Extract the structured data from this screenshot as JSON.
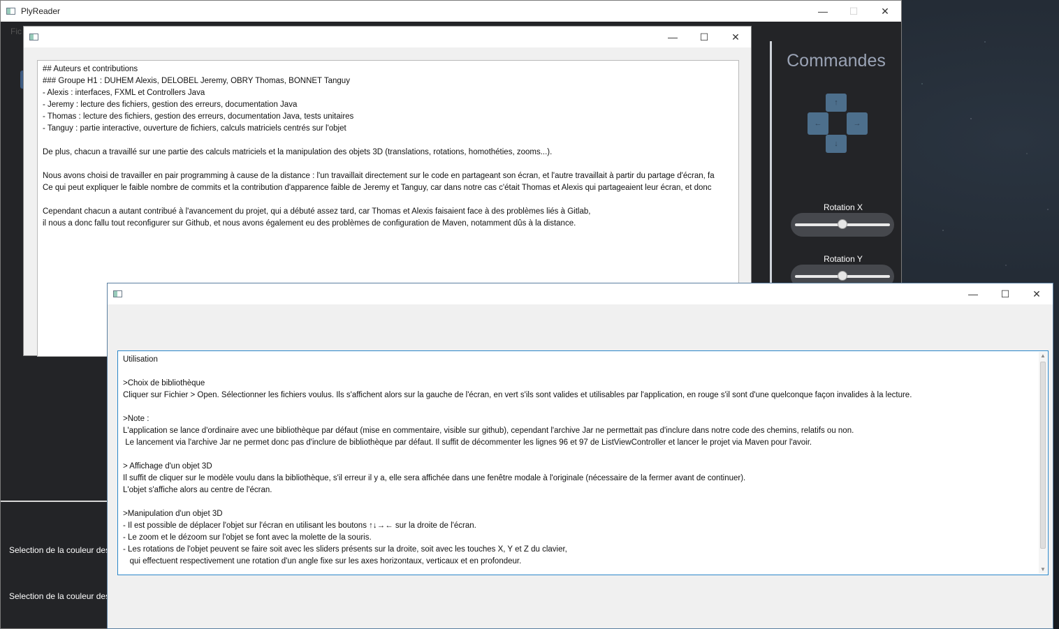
{
  "main_window": {
    "title": "PlyReader",
    "menu_fragment": "Fic",
    "minimize": "—",
    "maximize": "☐",
    "close": "✕",
    "left_labels": [
      "Selection de la couleur des",
      "Selection de la couleur des"
    ],
    "commands": {
      "title": "Commandes",
      "arrows": {
        "up": "↑",
        "left": "←",
        "right": "→",
        "down": "↓"
      },
      "sliders": [
        {
          "label": "Rotation X",
          "value": 0.5
        },
        {
          "label": "Rotation Y",
          "value": 0.5
        }
      ]
    }
  },
  "authors_window": {
    "minimize": "—",
    "maximize": "☐",
    "close": "✕",
    "lines": [
      "## Auteurs et contributions",
      "### Groupe H1 : DUHEM Alexis, DELOBEL Jeremy, OBRY Thomas, BONNET Tanguy",
      "- Alexis : interfaces, FXML et Controllers Java",
      "- Jeremy : lecture des fichiers, gestion des erreurs, documentation Java",
      "- Thomas : lecture des fichiers, gestion des erreurs, documentation Java, tests unitaires",
      "- Tanguy : partie interactive, ouverture de fichiers, calculs matriciels centrés sur l'objet",
      "",
      "De plus, chacun a travaillé sur une partie des calculs matriciels et la manipulation des objets 3D (translations, rotations, homothéties, zooms...).",
      "",
      "Nous avons choisi de travailler en pair programming à cause de la distance : l'un travaillait directement sur le code en partageant son écran, et l'autre travaillait à partir du partage d'écran, fa",
      "Ce qui peut expliquer le faible nombre de commits et la contribution d'apparence faible de Jeremy et Tanguy, car dans notre cas c'était Thomas et Alexis qui partageaient leur écran, et donc",
      "",
      "Cependant chacun a autant contribué à l'avancement du projet, qui a débuté assez tard, car Thomas et Alexis faisaient face à des problèmes liés à Gitlab,",
      "il nous a donc fallu tout reconfigurer sur Github, et nous avons également eu des problèmes de configuration de Maven, notamment dûs à la distance."
    ]
  },
  "usage_window": {
    "minimize": "—",
    "maximize": "☐",
    "close": "✕",
    "scroll_up": "▲",
    "scroll_down": "▼",
    "lines": [
      "Utilisation",
      "",
      ">Choix de bibliothèque",
      "Cliquer sur Fichier > Open. Sélectionner les fichiers voulus. Ils s'affichent alors sur la gauche de l'écran, en vert s'ils sont valides et utilisables par l'application, en rouge s'il sont d'une quelconque façon invalides à la lecture.",
      "",
      ">Note :",
      "L'application se lance d'ordinaire avec une bibliothèque par défaut (mise en commentaire, visible sur github), cependant l'archive Jar ne permettait pas d'inclure dans notre code des chemins, relatifs ou non.",
      " Le lancement via l'archive Jar ne permet donc pas d'inclure de bibliothèque par défaut. Il suffit de décommenter les lignes 96 et 97 de ListViewController et lancer le projet via Maven pour l'avoir.",
      "",
      "> Affichage d'un objet 3D",
      "Il suffit de cliquer sur le modèle voulu dans la bibliothèque, s'il erreur il y a, elle sera affichée dans une fenêtre modale à l'originale (nécessaire de la fermer avant de continuer).",
      "L'objet s'affiche alors au centre de l'écran.",
      "",
      ">Manipulation d'un objet 3D",
      "- Il est possible de déplacer l'objet sur l'écran en utilisant les boutons ↑↓→← sur la droite de l'écran.",
      "- Le zoom et le dézoom sur l'objet se font avec la molette de la souris.",
      "- Les rotations de l'objet peuvent se faire soit avec les sliders présents sur la droite, soit avec les touches X, Y et Z du clavier,",
      "   qui effectuent respectivement une rotation d'un angle fixe sur les axes horizontaux, verticaux et en profondeur."
    ]
  }
}
